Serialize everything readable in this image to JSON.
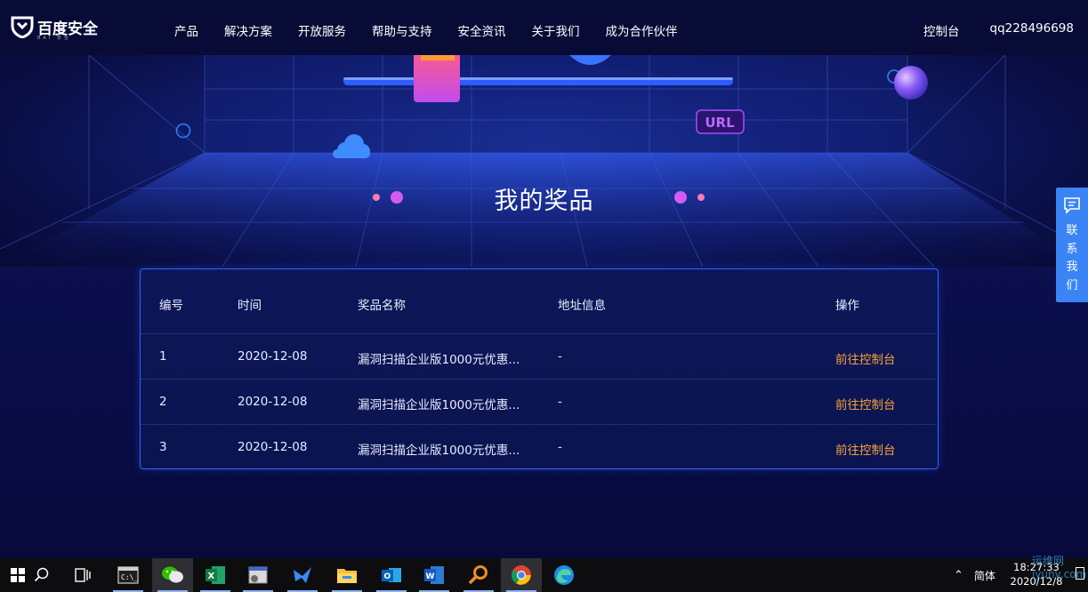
{
  "brand": {
    "name": "百度安全",
    "tagline": "BAI 安全"
  },
  "nav": {
    "links": [
      "产品",
      "解决方案",
      "开放服务",
      "帮助与支持",
      "安全资讯",
      "关于我们",
      "成为合作伙伴"
    ],
    "console": "控制台",
    "user": "qq228496698"
  },
  "hero": {
    "title": "我的奖品",
    "badge": "URL"
  },
  "table": {
    "headers": [
      "编号",
      "时间",
      "奖品名称",
      "地址信息",
      "操作"
    ],
    "rows": [
      {
        "id": "1",
        "time": "2020-12-08",
        "prize": "漏洞扫描企业版1000元优惠...",
        "address": "-",
        "action": "前往控制台"
      },
      {
        "id": "2",
        "time": "2020-12-08",
        "prize": "漏洞扫描企业版1000元优惠...",
        "address": "-",
        "action": "前往控制台"
      },
      {
        "id": "3",
        "time": "2020-12-08",
        "prize": "漏洞扫描企业版1000元优惠...",
        "address": "-",
        "action": "前往控制台"
      }
    ]
  },
  "side_contact": {
    "chars": [
      "联",
      "系",
      "我",
      "们"
    ]
  },
  "taskbar": {
    "apps": [
      "start-icon",
      "search-icon",
      "task-view-icon",
      "terminal-icon",
      "wechat-icon",
      "excel-icon",
      "app-icon",
      "feishu-icon",
      "file-explorer-icon",
      "outlook-icon",
      "word-icon",
      "search-tool-icon",
      "chrome-icon",
      "edge-icon"
    ],
    "ime": "简体",
    "time": "18:27:33",
    "date": "2020/12/8"
  },
  "watermark": "运维网 iyunv.com",
  "colors": {
    "accent": "#2f64ff",
    "action": "#f7a23b",
    "side": "#3a84f5"
  }
}
